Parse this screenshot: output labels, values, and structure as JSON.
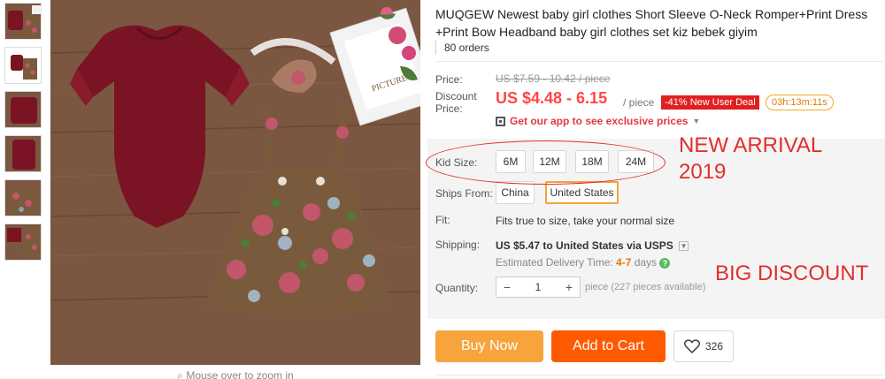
{
  "product": {
    "title": "MUQGEW Newest baby girl clothes Short Sleeve O-Neck Romper+Print Dress +Print Bow Headband baby girl clothes set kiz bebek giyim",
    "orders": "80 orders"
  },
  "gallery": {
    "zoom_hint": "Mouse over to zoom in",
    "colors": {
      "romper": "#7a1424",
      "wood": "#7b5640",
      "dress": "#7a5a3c",
      "flower": "#c2566b"
    }
  },
  "price": {
    "label": "Price:",
    "original": "US $7.59 - 10.42 / piece",
    "discount_label_1": "Discount",
    "discount_label_2": "Price:",
    "current": "US $4.48 - 6.15",
    "per": "/ piece",
    "deal": "-41% New User Deal",
    "timer": "03h:13m:11s",
    "app_promo": "Get our app to see exclusive prices"
  },
  "kid_size": {
    "label": "Kid Size:",
    "options": [
      "6M",
      "12M",
      "18M",
      "24M"
    ]
  },
  "ships_from": {
    "label": "Ships From:",
    "options": [
      "China",
      "United States"
    ],
    "selected": "United States"
  },
  "fit": {
    "label": "Fit:",
    "text": "Fits true to size, take your normal size"
  },
  "shipping": {
    "label": "Shipping:",
    "price": "US $5.47",
    "text": "to United States via USPS",
    "delivery_label": "Estimated Delivery Time:",
    "delivery_days": "4-7",
    "delivery_unit": "days"
  },
  "quantity": {
    "label": "Quantity:",
    "minus": "−",
    "value": "1",
    "plus": "+",
    "available": "piece (227 pieces available)"
  },
  "actions": {
    "buy_now": "Buy Now",
    "add_to_cart": "Add to Cart",
    "wishlist_count": "326"
  },
  "overlay": {
    "new_arrival_1": "NEW ARRIVAL",
    "new_arrival_2": "2019",
    "big_discount": "BIG DISCOUNT",
    "color": "#e0302e"
  }
}
